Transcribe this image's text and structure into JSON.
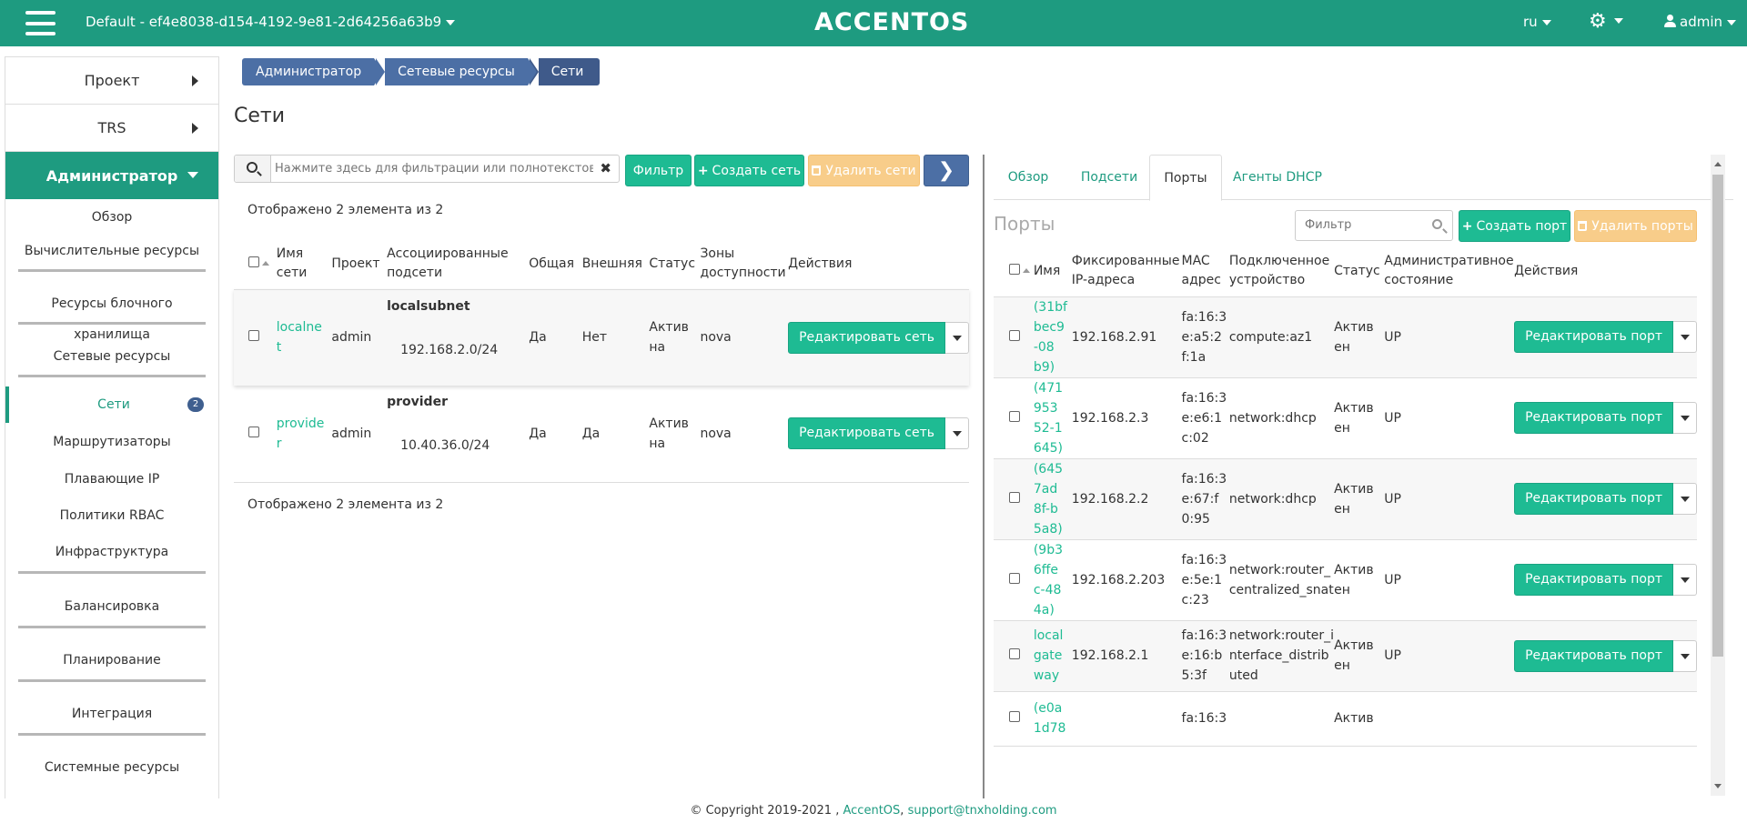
{
  "header": {
    "project": "Default - ef4e8038-d154-4192-9e81-2d64256a63b9",
    "logo": "ACCENTOS",
    "lang": "ru",
    "user": "admin"
  },
  "sidebar": {
    "project": "Проект",
    "trs": "TRS",
    "admin": "Администратор",
    "overview": "Обзор",
    "compute": "Вычислительные ресурсы",
    "block": "Ресурсы блочного хранилища",
    "network": "Сетевые ресурсы",
    "networks": "Сети",
    "networks_badge": "2",
    "routers": "Маршрутизаторы",
    "floating": "Плавающие IP",
    "rbac": "Политики RBAC",
    "infra": "Инфраструктура",
    "balancing": "Балансировка",
    "planning": "Планирование",
    "integration": "Интеграция",
    "system": "Системные ресурсы"
  },
  "breadcrumb": [
    "Администратор",
    "Сетевые ресурсы",
    "Сети"
  ],
  "page_title": "Сети",
  "left": {
    "search_placeholder": "Нажмите здесь для фильтрации или полнотекстового ...",
    "filter_btn": "Фильтр",
    "create_btn": "Создать сеть",
    "delete_btn": "Удалить сети",
    "count": "Отображено 2 элемента из 2",
    "columns": {
      "name": [
        "Имя",
        "сети"
      ],
      "project": "Проект",
      "subnets": [
        "Ассоциированные",
        "подсети"
      ],
      "shared": "Общая",
      "external": "Внешняя",
      "status": "Статус",
      "zones": [
        "Зоны",
        "доступности"
      ],
      "actions": "Действия"
    },
    "rows": [
      {
        "name": [
          "localne",
          "t"
        ],
        "project": "admin",
        "subnet_name": "localsubnet",
        "subnet_cidr": "192.168.2.0/24",
        "shared": "Да",
        "external": "Нет",
        "status": [
          "Актив",
          "на"
        ],
        "zone": "nova",
        "action": "Редактировать сеть"
      },
      {
        "name": [
          "provide",
          "r"
        ],
        "project": "admin",
        "subnet_name": "provider",
        "subnet_cidr": "10.40.36.0/24",
        "shared": "Да",
        "external": "Да",
        "status": [
          "Актив",
          "на"
        ],
        "zone": "nova",
        "action": "Редактировать сеть"
      }
    ]
  },
  "right": {
    "tabs": [
      "Обзор",
      "Подсети",
      "Порты",
      "Агенты DHCP"
    ],
    "title": "Порты",
    "filter_placeholder": "Фильтр",
    "create_btn": "Создать порт",
    "delete_btn": "Удалить порты",
    "columns": {
      "name": "Имя",
      "fixed_ip": [
        "Фиксированные",
        "IP-адреса"
      ],
      "mac": [
        "MAC",
        "адрес"
      ],
      "device": [
        "Подключенное",
        "устройство"
      ],
      "status": "Статус",
      "admin_state": [
        "Административное",
        "состояние"
      ],
      "actions": "Действия"
    },
    "rows": [
      {
        "name": [
          "(31bf",
          "bec9",
          "-08",
          "b9)"
        ],
        "ip": "192.168.2.91",
        "mac": [
          "fa:16:3",
          "e:a5:2",
          "f:1a"
        ],
        "device": [
          "compute:az1"
        ],
        "status": [
          "Актив",
          "ен"
        ],
        "state": "UP",
        "action": "Редактировать порт"
      },
      {
        "name": [
          "(471",
          "953",
          "52-1",
          "645)"
        ],
        "ip": "192.168.2.3",
        "mac": [
          "fa:16:3",
          "e:e6:1",
          "c:02"
        ],
        "device": [
          "network:dhcp"
        ],
        "status": [
          "Актив",
          "ен"
        ],
        "state": "UP",
        "action": "Редактировать порт"
      },
      {
        "name": [
          "(645",
          "7ad",
          "8f-b",
          "5a8)"
        ],
        "ip": "192.168.2.2",
        "mac": [
          "fa:16:3",
          "e:67:f",
          "0:95"
        ],
        "device": [
          "network:dhcp"
        ],
        "status": [
          "Актив",
          "ен"
        ],
        "state": "UP",
        "action": "Редактировать порт"
      },
      {
        "name": [
          "(9b3",
          "6ffe",
          "c-48",
          "4a)"
        ],
        "ip": "192.168.2.203",
        "mac": [
          "fa:16:3",
          "e:5e:1",
          "c:23"
        ],
        "device": [
          "network:router_",
          "centralized_snat"
        ],
        "status": [
          "Актив",
          "ен"
        ],
        "state": "UP",
        "action": "Редактировать порт"
      },
      {
        "name": [
          "local",
          "gate",
          "way"
        ],
        "ip": "192.168.2.1",
        "mac": [
          "fa:16:3",
          "e:16:b",
          "5:3f"
        ],
        "device": [
          "network:router_i",
          "nterface_distrib",
          "uted"
        ],
        "status": [
          "Актив",
          "ен"
        ],
        "state": "UP",
        "action": "Редактировать порт"
      },
      {
        "name": [
          "(e0a",
          "1d78"
        ],
        "ip": "",
        "mac": [
          "fa:16:3"
        ],
        "device": [
          ""
        ],
        "status": [
          "Актив"
        ],
        "state": "",
        "action": ""
      }
    ]
  },
  "footer": {
    "copyright": "© Copyright 2019-2021 ,",
    "brand": "AccentOS",
    "sep": ",",
    "email": "support@tnxholding.com"
  }
}
